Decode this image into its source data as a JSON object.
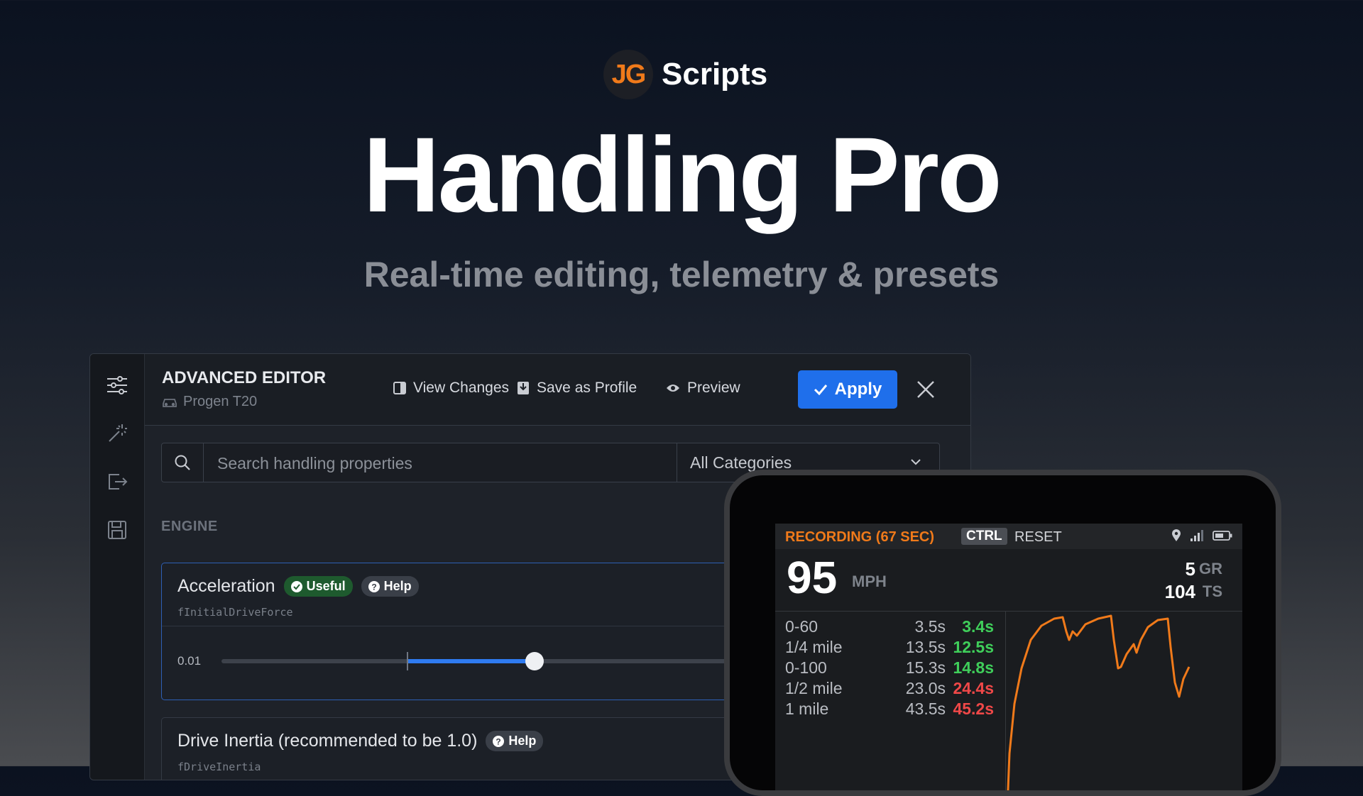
{
  "brand": {
    "mark": "JG",
    "name": "Scripts"
  },
  "hero": {
    "title": "Handling Pro",
    "subtitle": "Real-time editing, telemetry & presets"
  },
  "editor": {
    "title": "ADVANCED EDITOR",
    "vehicle": "Progen T20",
    "toolbar": {
      "view_changes": "View Changes",
      "save_profile": "Save as Profile",
      "preview": "Preview",
      "apply": "Apply"
    },
    "search": {
      "placeholder": "Search handling properties",
      "category": "All Categories"
    },
    "section": "ENGINE",
    "properties": [
      {
        "name": "Acceleration",
        "badge_useful": "Useful",
        "badge_help": "Help",
        "code": "fInitialDriveForce",
        "min_label": "0.01",
        "default_fraction": 0.29,
        "value_fraction": 0.49
      },
      {
        "name": "Drive Inertia (recommended to be 1.0)",
        "badge_help": "Help",
        "code": "fDriveInertia"
      }
    ]
  },
  "telemetry": {
    "recording": "RECORDING (67 SEC)",
    "ctrl": "CTRL",
    "reset": "RESET",
    "speed": "95",
    "speed_unit": "MPH",
    "gear": "5",
    "gear_label": "GR",
    "top_speed": "104",
    "top_speed_label": "TS",
    "colors": {
      "faster": "#3fce5a",
      "slower": "#f04848",
      "accent": "#f07a1a"
    },
    "times": [
      {
        "label": "0-60",
        "reference": "3.5s",
        "current": "3.4s",
        "status": "faster"
      },
      {
        "label": "1/4 mile",
        "reference": "13.5s",
        "current": "12.5s",
        "status": "faster"
      },
      {
        "label": "0-100",
        "reference": "15.3s",
        "current": "14.8s",
        "status": "faster"
      },
      {
        "label": "1/2 mile",
        "reference": "23.0s",
        "current": "24.4s",
        "status": "slower"
      },
      {
        "label": "1 mile",
        "reference": "43.5s",
        "current": "45.2s",
        "status": "slower"
      }
    ]
  }
}
